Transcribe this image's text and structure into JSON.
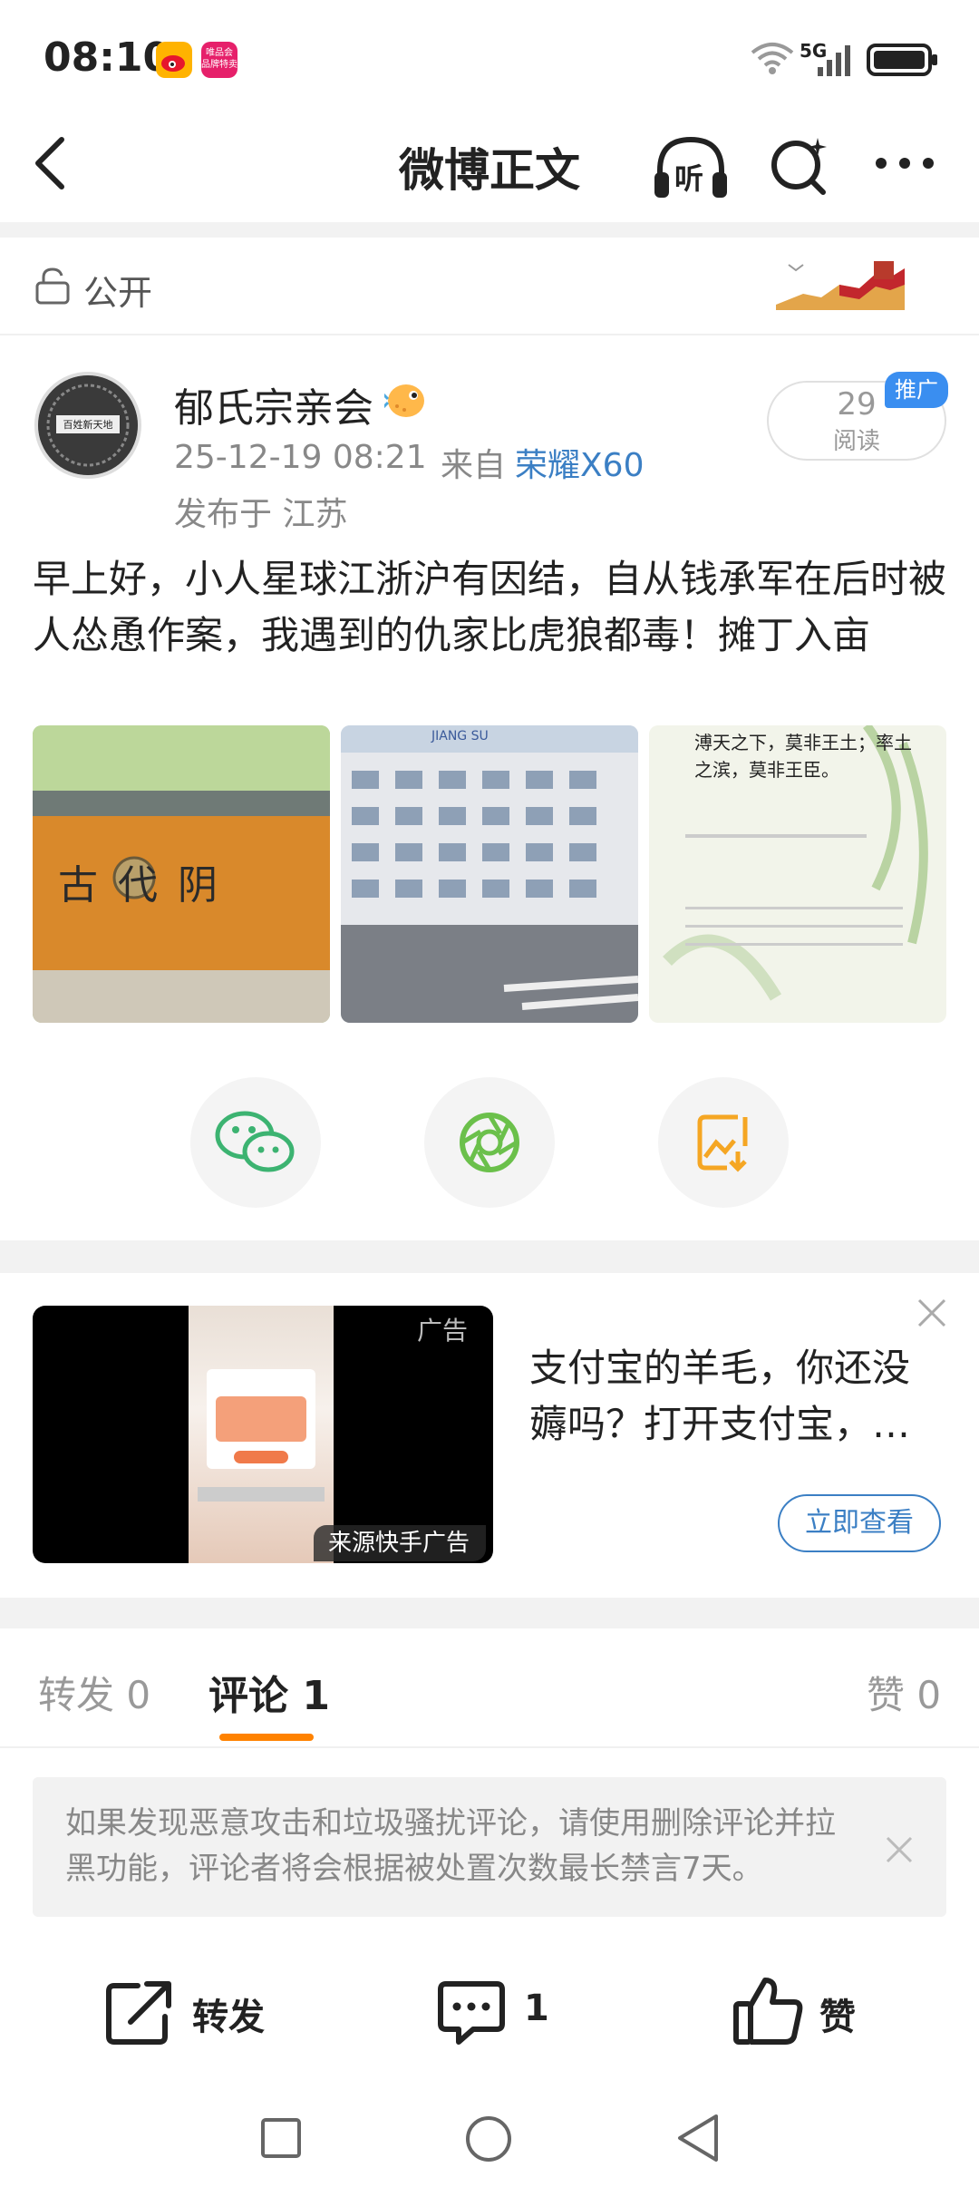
{
  "status_bar": {
    "time": "08:10",
    "network": "5G",
    "vip_badge": "唯品会 品牌特卖"
  },
  "header": {
    "title": "微博正文",
    "listen_label": "听"
  },
  "visibility": {
    "label": "公开"
  },
  "post": {
    "author": "郁氏宗亲会",
    "avatar_text": "百姓新天地",
    "time": "25-12-19 08:21",
    "source_label": "来自",
    "device": "荣耀X60",
    "location": "发布于 江苏",
    "read_count": "29",
    "read_label": "阅读",
    "promo_tag": "推广",
    "text": "早上好，小人星球江浙沪有因结，自从钱承军在后时被人怂恿作案，我遇到的仇家比虎狼都毒！摊丁入亩",
    "images": [
      {
        "caption": "古 代 阴"
      },
      {
        "caption": "JIANG SU"
      },
      {
        "caption": "溥天之下，莫非王土；率土之滨，莫非王臣。"
      }
    ]
  },
  "ad": {
    "label": "广告",
    "source": "来源快手广告",
    "title": "支付宝的羊毛，你还没薅吗？打开支付宝，…",
    "cta": "立即查看"
  },
  "tabs": {
    "repost": "转发 0",
    "comment": "评论 1",
    "like": "赞 0"
  },
  "notice": {
    "text": "如果发现恶意攻击和垃圾骚扰评论，请使用删除评论并拉黑功能，评论者将会根据被处置次数最长禁言7天。"
  },
  "action_bar": {
    "repost": "转发",
    "comment_count": "1",
    "like": "赞"
  },
  "colors": {
    "accent": "#ff8200",
    "link": "#3b7fc4",
    "promo": "#3a8ef0"
  }
}
